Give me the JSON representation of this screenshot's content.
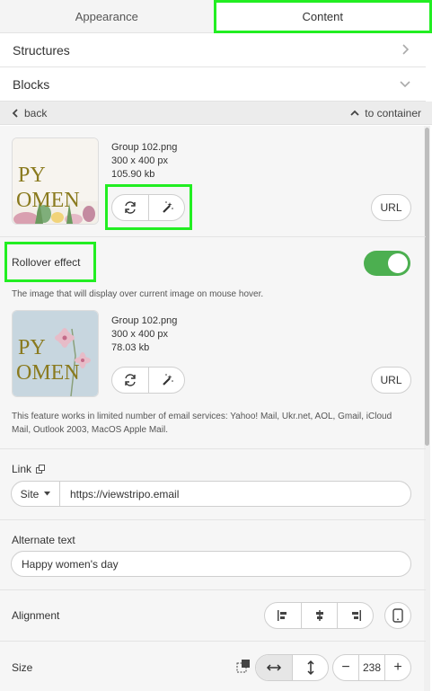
{
  "tabs": [
    "Appearance",
    "Content"
  ],
  "accordion": {
    "structures": "Structures",
    "blocks": "Blocks"
  },
  "nav": {
    "back": "back",
    "to_container": "to container"
  },
  "image": {
    "filename": "Group 102.png",
    "dimensions": "300 x 400 px",
    "size": "105.90 kb",
    "thumb_text": [
      "PY",
      "OMEN"
    ],
    "url_label": "URL"
  },
  "rollover": {
    "label": "Rollover effect",
    "enabled": true,
    "description": "The image that will display over current image on mouse hover.",
    "filename": "Group 102.png",
    "dimensions": "300 x 400 px",
    "size": "78.03 kb",
    "thumb_text": [
      "PY",
      "OMEN"
    ],
    "url_label": "URL",
    "note_line1": "This feature works in limited number of email services: Yahoo! Mail, Ukr.net, AOL, Gmail, iCloud",
    "note_line2": "Mail, Outlook 2003, MacOS Apple Mail."
  },
  "link": {
    "label": "Link",
    "select": "Site",
    "value": "https://viewstripo.email"
  },
  "alt": {
    "label": "Alternate text",
    "value": "Happy women's day"
  },
  "alignment": {
    "label": "Alignment"
  },
  "size": {
    "label": "Size",
    "value": "238",
    "minus": "−",
    "plus": "+"
  },
  "colors": {
    "highlight": "#22ee22",
    "toggle_on": "#4caf50",
    "gold_text": "#8a7a1e"
  }
}
